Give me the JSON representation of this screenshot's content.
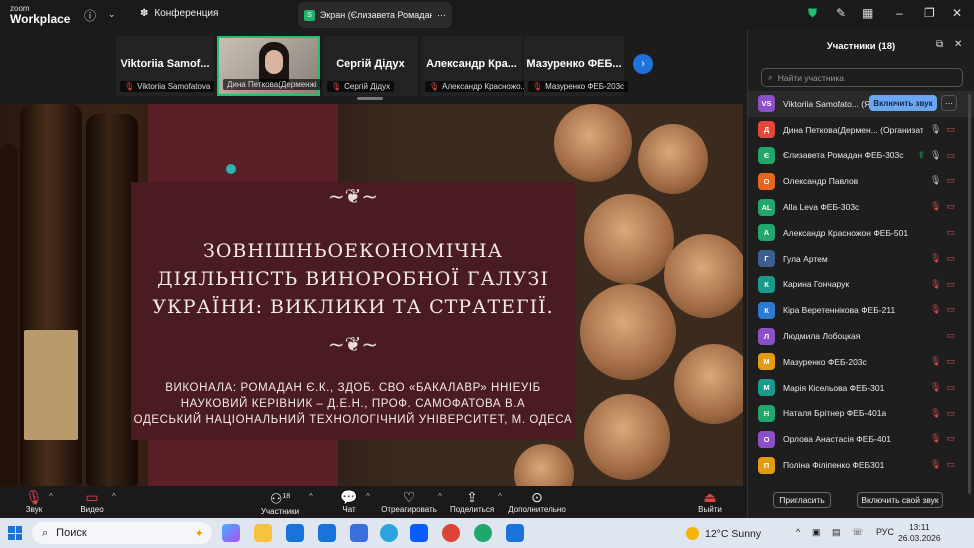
{
  "app": {
    "logo_line1": "zoom",
    "logo_line2": "Workplace"
  },
  "topbar": {
    "meeting_label": "Конференция",
    "screen_tab_label": "Экран (Єлизавета Ромадан ФЕБ",
    "screen_tab_icon": "S"
  },
  "thumbnails": [
    {
      "big_name": "Viktoriia Samof...",
      "tag": "Viktoriia Samofatova",
      "muted": true
    },
    {
      "big_name": "",
      "tag": "Дина Петкова(Дерменжі",
      "muted": false,
      "video": true
    },
    {
      "big_name": "Сергій Дідух",
      "tag": "Сергій Дідух",
      "muted": true
    },
    {
      "big_name": "Александр Кра...",
      "tag": "Александр Красножо...",
      "muted": true
    },
    {
      "big_name": "Мазуренко ФЕБ...",
      "tag": "Мазуренко ФЕБ-203с",
      "muted": true
    }
  ],
  "slide": {
    "title_lines": [
      "ЗОВНІШНЬОЕКОНОМІЧНА",
      "ДІЯЛЬНІСТЬ ВИНОРОБНОЇ ГАЛУЗІ",
      "УКРАЇНИ: ВИКЛИКИ ТА СТРАТЕГІЇ."
    ],
    "sub_lines": [
      "ВИКОНАЛА: РОМАДАН Є.К., ЗДОБ. СВО «БАКАЛАВР» ННІЕУІБ",
      "НАУКОВИЙ КЕРІВНИК – Д.Е.Н., ПРОФ. САМОФАТОВА В.А",
      "ОДЕСЬКИЙ НАЦІОНАЛЬНИЙ ТЕХНОЛОГІЧНИЙ УНІВЕРСИТЕТ, М. ОДЕСА"
    ]
  },
  "panel": {
    "title": "Участники (18)",
    "search_placeholder": "Найти участника",
    "unmute_label": "Включить звук",
    "invite_label": "Пригласить",
    "unmute_self_label": "Включить свой звук",
    "participants": [
      {
        "initials": "VS",
        "color": "#8a4fc9",
        "name": "Viktoriia Samofato... (Я)",
        "mic": "muted",
        "cam": ""
      },
      {
        "initials": "Д",
        "color": "#e0493a",
        "name": "Дина Петкова(Дермен... (Организатор)",
        "mic": "on",
        "cam": "off"
      },
      {
        "initials": "Є",
        "color": "#21a66b",
        "name": "Єлизавета Ромадан ФЕБ-303с",
        "mic": "on",
        "cam": "off",
        "share": true
      },
      {
        "initials": "О",
        "color": "#e8651e",
        "name": "Олександр Павлов",
        "mic": "on",
        "cam": "off"
      },
      {
        "initials": "AL",
        "color": "#21a66b",
        "name": "Alla Leva ФЕБ-303с",
        "mic": "muted",
        "cam": "off"
      },
      {
        "initials": "А",
        "color": "#21a66b",
        "name": "Александр Красножон ФЕБ-501",
        "mic": "",
        "cam": "off"
      },
      {
        "initials": "Г",
        "color": "#3d5f8f",
        "name": "Гула Артем",
        "mic": "muted",
        "cam": "off"
      },
      {
        "initials": "К",
        "color": "#1a9a8a",
        "name": "Карина Гончарук",
        "mic": "muted",
        "cam": "off"
      },
      {
        "initials": "К",
        "color": "#2c7ad1",
        "name": "Кіра Веретеннікова ФЕБ-211",
        "mic": "muted",
        "cam": "off"
      },
      {
        "initials": "Л",
        "color": "#8a4fc9",
        "name": "Людмила Лобоцкая",
        "mic": "",
        "cam": "off"
      },
      {
        "initials": "М",
        "color": "#e39b14",
        "name": "Мазуренко ФЕБ-203с",
        "mic": "muted",
        "cam": "off"
      },
      {
        "initials": "М",
        "color": "#1a9a8a",
        "name": "Марія Кісельова ФЕБ-301",
        "mic": "muted",
        "cam": "off"
      },
      {
        "initials": "Н",
        "color": "#21a66b",
        "name": "Наталя Брітнер ФЕБ-401а",
        "mic": "muted",
        "cam": "off"
      },
      {
        "initials": "О",
        "color": "#8a4fc9",
        "name": "Орлова Анастасія ФЕБ-401",
        "mic": "muted",
        "cam": "off"
      },
      {
        "initials": "П",
        "color": "#e39b14",
        "name": "Поліна Філіпенко ФЕБ301",
        "mic": "muted",
        "cam": "off"
      }
    ]
  },
  "toolbar": {
    "audio": "Звук",
    "video": "Видео",
    "participants": "Участники",
    "participants_count": "18",
    "chat": "Чат",
    "react": "Отреагировать",
    "share": "Поделиться",
    "more": "Дополнительно",
    "leave": "Выйти"
  },
  "taskbar": {
    "search_label": "Поиск",
    "weather": "12°C  Sunny",
    "lang": "РУС",
    "time": "13:11",
    "date": "26.03.2026"
  }
}
